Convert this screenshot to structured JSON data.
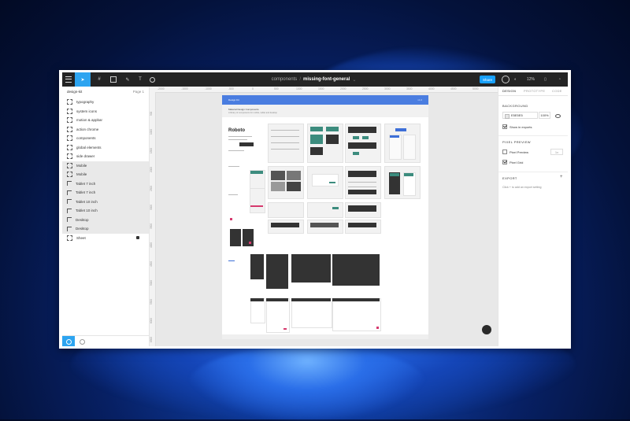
{
  "toolbar": {
    "project": "components",
    "file": "missing-font-general",
    "share_label": "Share",
    "zoom": "12%"
  },
  "layers_panel": {
    "header": "design-kit",
    "page_label": "Page 1",
    "items": [
      {
        "name": "typography"
      },
      {
        "name": "system icons"
      },
      {
        "name": "motion & appbar"
      },
      {
        "name": "action chrome"
      },
      {
        "name": "components"
      },
      {
        "name": "global elements"
      },
      {
        "name": "side drawer"
      },
      {
        "name": "Mobile"
      },
      {
        "name": "Mobile"
      },
      {
        "name": "Tablet 7 inch"
      },
      {
        "name": "Tablet 7 inch"
      },
      {
        "name": "Tablet 10 inch"
      },
      {
        "name": "Tablet 10 inch"
      },
      {
        "name": "Desktop"
      },
      {
        "name": "Desktop"
      },
      {
        "name": "Sheet"
      }
    ]
  },
  "canvas": {
    "ruler_top": [
      "-2000",
      "-1500",
      "-1000",
      "-500",
      "0",
      "500",
      "1000",
      "1500",
      "2000",
      "2500",
      "3000",
      "3500",
      "4000",
      "4500",
      "5000"
    ],
    "ruler_left": [
      "500",
      "1000",
      "1500",
      "2000",
      "2500",
      "3000",
      "3500",
      "4000",
      "4500",
      "5000",
      "5500",
      "6000",
      "6500"
    ],
    "artboard_header": "Design Kit",
    "artboard_header_right": "v1.0",
    "artboard_sub_title": "Material Design Components",
    "artboard_sub_text": "A library of components for mobile, tablet and desktop",
    "roboto": "Roboto"
  },
  "properties": {
    "tabs": [
      "DESIGN",
      "PROTOTYPE",
      "CODE"
    ],
    "background_title": "BACKGROUND",
    "color_hex": "E5E5E5",
    "opacity": "100%",
    "show_exports_label": "Show in exports",
    "pixel_preview_title": "PIXEL PREVIEW",
    "pixel_preview_label": "Pixel Preview",
    "pixel_preview_value": "1x",
    "pixel_grid_label": "Pixel Grid",
    "export_title": "EXPORT",
    "export_hint": "Click + to add an export setting"
  }
}
